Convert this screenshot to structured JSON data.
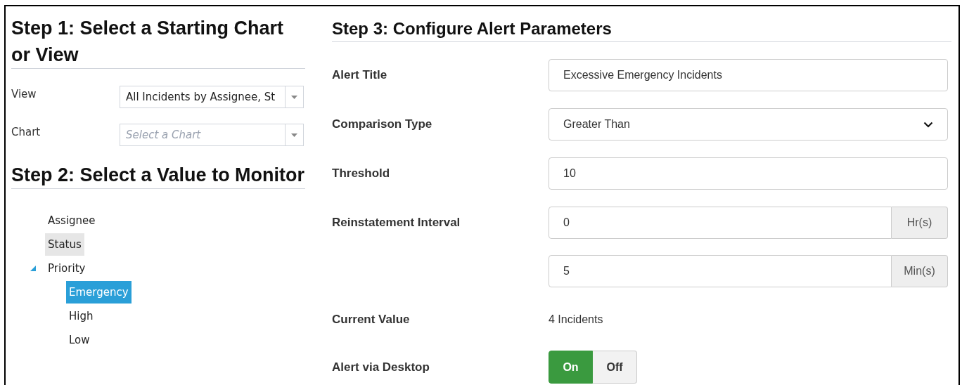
{
  "step1": {
    "heading": "Step 1: Select a Starting Chart or View",
    "fields": [
      {
        "label": "View",
        "value": "All Incidents by Assignee, St"
      },
      {
        "label": "Chart",
        "placeholder": "Select a Chart"
      }
    ]
  },
  "step2": {
    "heading": "Step 2: Select a Value to Monitor",
    "tree": [
      {
        "label": "Assignee",
        "selected": false,
        "hovered": false
      },
      {
        "label": "Status",
        "selected": false,
        "hovered": true
      },
      {
        "label": "Priority",
        "selected": false,
        "hovered": false,
        "expanded": true,
        "children": [
          {
            "label": "Emergency",
            "selected": true,
            "hovered": false
          },
          {
            "label": "High",
            "selected": false,
            "hovered": false
          },
          {
            "label": "Low",
            "selected": false,
            "hovered": false
          }
        ]
      }
    ]
  },
  "step3": {
    "heading": "Step 3: Configure Alert Parameters",
    "rows": [
      {
        "kind": "input",
        "label": "Alert Title",
        "value": "Excessive Emergency Incidents"
      },
      {
        "kind": "select",
        "label": "Comparison Type",
        "value": "Greater Than"
      },
      {
        "kind": "input",
        "label": "Threshold",
        "value": "10"
      },
      {
        "kind": "addon",
        "label": "Reinstatement Interval",
        "value": "0",
        "addon": "Hr(s)"
      },
      {
        "kind": "addon",
        "value": "5",
        "addon": "Min(s)"
      },
      {
        "kind": "text",
        "label": "Current Value",
        "value": "4 Incidents"
      },
      {
        "kind": "toggle",
        "label": "Alert via Desktop",
        "options": [
          {
            "label": "On",
            "selected": true
          },
          {
            "label": "Off",
            "selected": false
          }
        ]
      }
    ]
  }
}
